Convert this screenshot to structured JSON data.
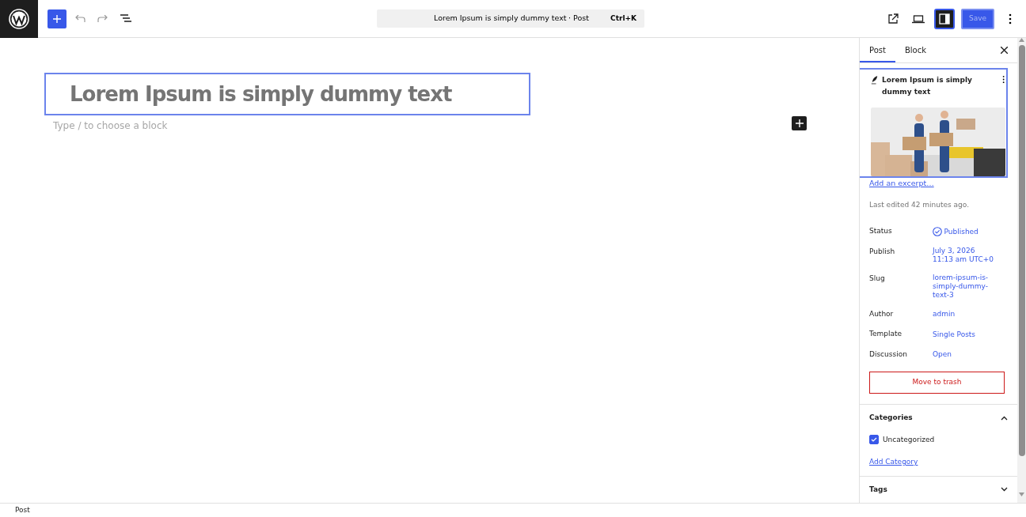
{
  "topbar": {
    "command_bar": {
      "title": "Lorem Ipsum is simply dummy text",
      "type": "· Post",
      "shortcut": "Ctrl+K"
    },
    "settings_toggle": {
      "on": true
    },
    "save_button": {
      "label": "Save",
      "disabled": true
    }
  },
  "editor": {
    "title": "Lorem Ipsum is simply dummy text",
    "title_selected": true,
    "placeholder": "Type / to choose a block"
  },
  "sidebar": {
    "tabs": [
      {
        "label": "Post",
        "selected": true
      },
      {
        "label": "Block",
        "selected": false
      }
    ],
    "post_card": {
      "title": "Lorem Ipsum is simply dummy text",
      "selected": true
    },
    "excerpt_link": "Add an excerpt…",
    "last_edited": "Last edited 42 minutes ago.",
    "fields": [
      {
        "label": "Status",
        "kind": "status",
        "value": [
          "Published"
        ]
      },
      {
        "label": "Publish",
        "kind": "link",
        "value": [
          "July 3, 2026",
          "11:13 am UTC+0"
        ]
      },
      {
        "label": "Slug",
        "kind": "link",
        "value": [
          "lorem-ipsum-is-simply-dummy-text-3"
        ]
      },
      {
        "label": "Author",
        "kind": "link",
        "value": [
          "admin"
        ]
      },
      {
        "label": "Template",
        "kind": "link",
        "value": [
          "Single Posts"
        ]
      },
      {
        "label": "Discussion",
        "kind": "link",
        "value": [
          "Open"
        ]
      }
    ],
    "trash_button": "Move to trash",
    "panels": [
      {
        "title": "Categories",
        "expanded": true,
        "categories": [
          {
            "label": "Uncategorized",
            "checked": true
          }
        ],
        "add_link": "Add Category"
      },
      {
        "title": "Tags",
        "expanded": false
      }
    ]
  },
  "footer": {
    "breadcrumb": "Post"
  }
}
